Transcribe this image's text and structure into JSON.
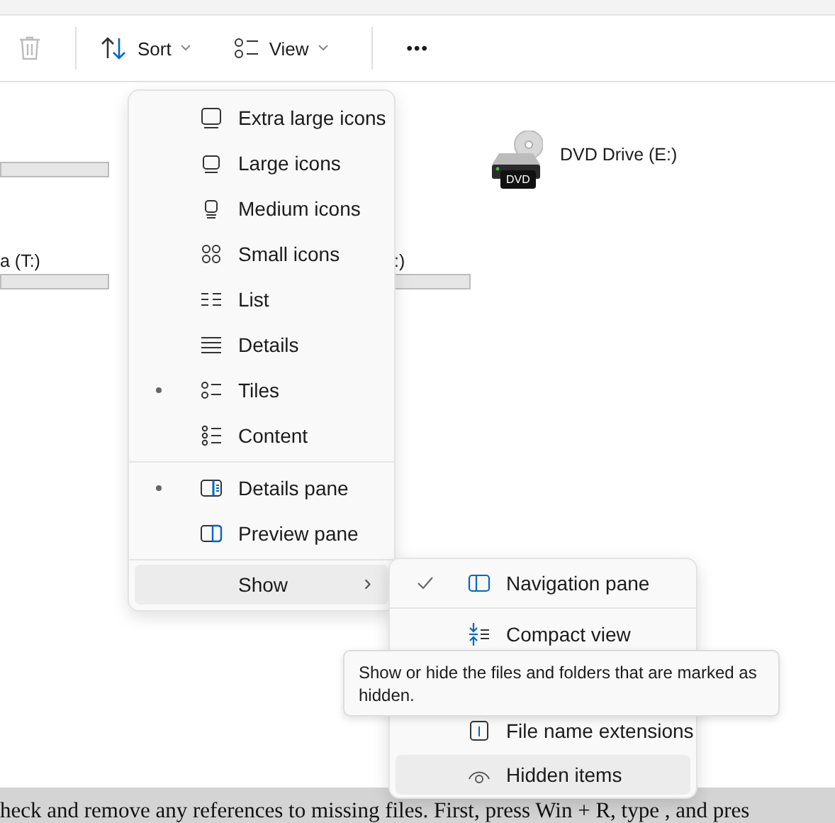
{
  "toolbar": {
    "sort": {
      "label": "Sort"
    },
    "view": {
      "label": "View"
    },
    "more": {
      "label": "•••"
    }
  },
  "drives": [
    {
      "kind": "bar"
    },
    {
      "kind": "device",
      "name": "DVD Drive (E:)",
      "badge": "DVD"
    },
    {
      "kind": "bar",
      "name": "a (T:)"
    },
    {
      "kind": "bar",
      "name": ":)"
    }
  ],
  "view_menu": {
    "groups": [
      [
        {
          "label": "Extra large icons",
          "selected": false
        },
        {
          "label": "Large icons",
          "selected": false
        },
        {
          "label": "Medium icons",
          "selected": false
        },
        {
          "label": "Small icons",
          "selected": false
        },
        {
          "label": "List",
          "selected": false
        },
        {
          "label": "Details",
          "selected": false
        },
        {
          "label": "Tiles",
          "selected": true
        },
        {
          "label": "Content",
          "selected": false
        }
      ],
      [
        {
          "label": "Details pane",
          "selected": true
        },
        {
          "label": "Preview pane",
          "selected": false
        }
      ]
    ],
    "show": {
      "label": "Show",
      "highlighted": true,
      "arrow": "›"
    }
  },
  "show_menu": {
    "items": [
      {
        "label": "Navigation pane",
        "checked": true,
        "highlighted": false
      },
      {
        "label": "Compact view",
        "checked": false,
        "highlighted": false
      },
      {
        "label": "File name extensions",
        "checked": false,
        "highlighted": false
      },
      {
        "label": "Hidden items",
        "checked": false,
        "highlighted": true
      }
    ]
  },
  "tooltip": {
    "text": "Show or hide the files and folders that are marked as hidden."
  },
  "caption": {
    "text": "heck and remove any references to missing files. First, press Win + R, type , and pres"
  }
}
